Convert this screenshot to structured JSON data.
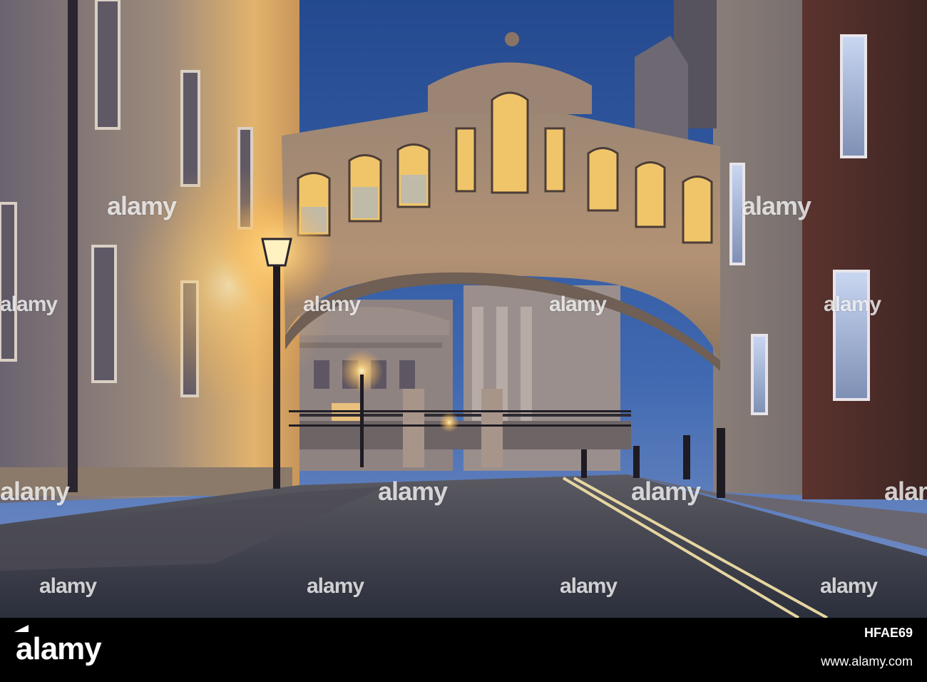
{
  "photo": {
    "subject": "Bridge of Sighs (Hertford Bridge), Oxford — New College Lane at dusk",
    "palette": {
      "sky": "#2f5aa3",
      "sky_low": "#6f8ec6",
      "stone_warm": "#c8a06a",
      "stone_cool": "#6c6a74",
      "lamp_glow": "#ffd27a",
      "road": "#3a3e4a",
      "brick": "#6b3a32"
    }
  },
  "watermark": {
    "text": "alamy",
    "repeats": 14
  },
  "footer": {
    "brand": "alamy",
    "image_id": "HFAE69",
    "url": "www.alamy.com"
  }
}
